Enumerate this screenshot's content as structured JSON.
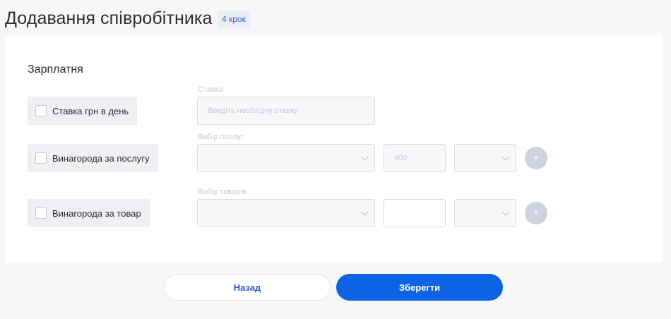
{
  "header": {
    "title": "Додавання співробітника",
    "step_badge": "4 крок"
  },
  "salary": {
    "section_title": "Зарплатня",
    "rate": {
      "checkbox_label": "Ставка грн в день",
      "checked": false,
      "field_label": "Ставка",
      "placeholder": "Введіть необхідну ставку",
      "value": ""
    },
    "service_reward": {
      "checkbox_label": "Винагорода за послугу",
      "checked": false,
      "field_label": "Вибір послуг",
      "select_value": "",
      "amount_value": "400",
      "unit_value": ""
    },
    "product_reward": {
      "checkbox_label": "Винагорода за товар",
      "checked": false,
      "field_label": "Вибір товарів",
      "select_value": "",
      "amount_value": "",
      "unit_value": ""
    },
    "add_icon": "+"
  },
  "footer": {
    "back_label": "Назад",
    "save_label": "Зберегти"
  },
  "colors": {
    "accent": "#0d63e6",
    "badge_bg": "#e9eef7",
    "plus_bg": "#cdd3de"
  }
}
